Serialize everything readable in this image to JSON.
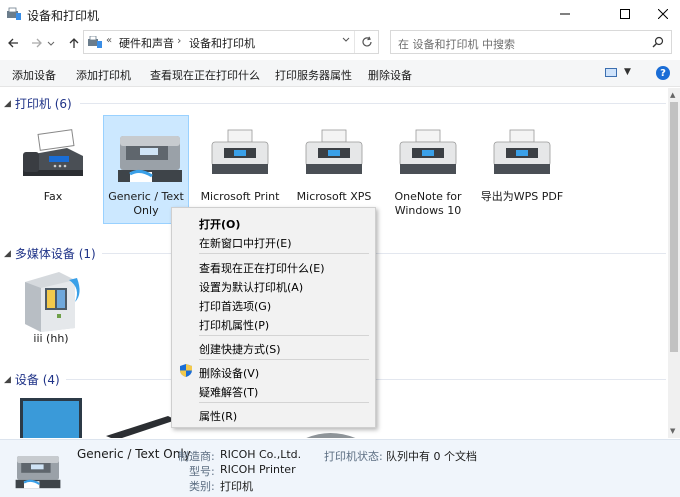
{
  "window": {
    "title": "设备和打印机",
    "minimize_icon": "minimize-icon",
    "maximize_icon": "maximize-icon",
    "close_icon": "close-icon"
  },
  "nav": {
    "address_chevron": "«",
    "breadcrumbs": [
      "硬件和声音",
      "设备和打印机"
    ],
    "search_placeholder": "在 设备和打印机 中搜索"
  },
  "toolbar": {
    "commands": [
      "添加设备",
      "添加打印机",
      "查看现在正在打印什么",
      "打印服务器属性",
      "删除设备"
    ],
    "help_label": "?"
  },
  "groups": {
    "printers": {
      "label": "打印机 (6)"
    },
    "multimedia": {
      "label": "多媒体设备 (1)"
    },
    "devices": {
      "label": "设备 (4)"
    }
  },
  "printers": [
    {
      "name": "Fax",
      "icon": "fax-icon"
    },
    {
      "name": "Generic / Text Only",
      "icon": "printer-icon",
      "selected": true
    },
    {
      "name": "Microsoft Print",
      "icon": "printer-icon"
    },
    {
      "name": "Microsoft XPS",
      "icon": "printer-icon"
    },
    {
      "name": "OneNote for Windows 10",
      "icon": "printer-icon"
    },
    {
      "name": "导出为WPS PDF",
      "icon": "printer-icon"
    }
  ],
  "multimedia": [
    {
      "name": "iii (hh)",
      "icon": "media-device-icon"
    }
  ],
  "context_menu": {
    "items": [
      {
        "label": "打开(O)",
        "bold": true
      },
      {
        "label": "在新窗口中打开(E)"
      },
      {
        "label": "查看现在正在打印什么(E)"
      },
      {
        "label": "设置为默认打印机(A)"
      },
      {
        "label": "打印首选项(G)"
      },
      {
        "label": "打印机属性(P)"
      },
      {
        "label": "创建快捷方式(S)"
      },
      {
        "label": "删除设备(V)",
        "icon": "uac-shield-icon"
      },
      {
        "label": "疑难解答(T)"
      },
      {
        "label": "属性(R)"
      }
    ]
  },
  "details": {
    "name": "Generic / Text Only",
    "manufacturer_label": "制造商:",
    "manufacturer": "RICOH Co.,Ltd.",
    "model_label": "型号:",
    "model": "RICOH Printer",
    "category_label": "类别:",
    "category": "打印机",
    "status_label": "打印机状态:",
    "status": "队列中有 0 个文档"
  },
  "colors": {
    "selection": "#cce8ff",
    "group_header": "#1e3287",
    "accent": "#1a6dd6"
  }
}
